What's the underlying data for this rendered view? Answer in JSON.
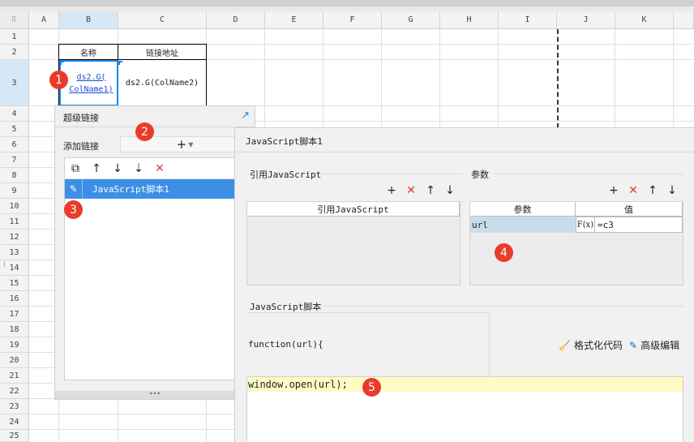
{
  "spreadsheet": {
    "columns": [
      "A",
      "B",
      "C",
      "D",
      "E",
      "F",
      "G",
      "H",
      "I",
      "J",
      "K"
    ],
    "rows": [
      "1",
      "2",
      "3",
      "4",
      "5",
      "6",
      "7",
      "8",
      "9",
      "10",
      "11",
      "12",
      "13",
      "14",
      "15",
      "16",
      "17",
      "18",
      "19",
      "20",
      "21",
      "22",
      "23",
      "24",
      "25"
    ],
    "cells": {
      "b2": "名称",
      "c2": "链接地址",
      "b3_line1": "ds2.G(",
      "b3_line2": "ColName1)",
      "c3": "ds2.G(ColName2)"
    }
  },
  "hyperlink_dialog": {
    "title": "超级链接",
    "add_link_label": "添加链接",
    "list_items": [
      "JavaScript脚本1"
    ]
  },
  "editor": {
    "title": "JavaScript脚本1",
    "ref_section_label": "引用JavaScript",
    "ref_column_header": "引用JavaScript",
    "params_section_label": "参数",
    "params_headers": [
      "参数",
      "值"
    ],
    "params": [
      {
        "name": "url",
        "fx": "F(x)",
        "value": "=c3"
      }
    ],
    "script_section_label": "JavaScript脚本",
    "code_lines": [
      "function(url){",
      "window.open(url);"
    ],
    "format_code_label": "格式化代码",
    "advanced_edit_label": "高级编辑"
  },
  "callouts": [
    "1",
    "2",
    "3",
    "4",
    "5"
  ],
  "colors": {
    "selection_blue": "#3d8fe6",
    "callout_red": "#ea3b2a",
    "link_blue": "#1b4fd1",
    "code_highlight": "#fefbc4"
  }
}
